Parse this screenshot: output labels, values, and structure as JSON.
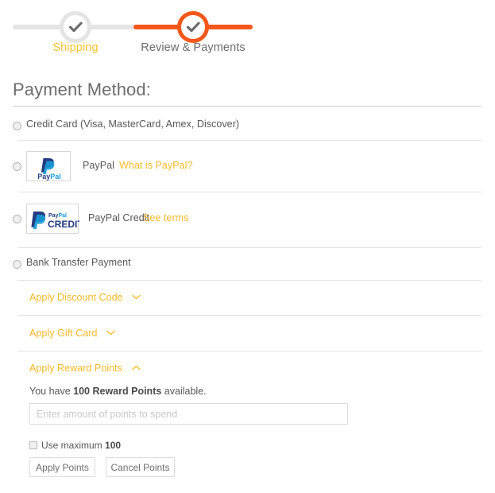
{
  "progress": {
    "steps": [
      {
        "id": "shipping",
        "label": "Shipping",
        "state": "complete",
        "icon": "check-icon",
        "color": "#e4e4e4",
        "label_color": "#f5c432"
      },
      {
        "id": "review-payments",
        "label": "Review & Payments",
        "state": "active",
        "icon": "check-icon",
        "color": "#f3581a",
        "label_color": "#6d6d6d"
      }
    ]
  },
  "page": {
    "title": "Payment Method:"
  },
  "payment_methods": [
    {
      "id": "credit-card",
      "label": "Credit Card (Visa, MasterCard, Amex, Discover)",
      "selected": false,
      "logo": null,
      "link": null
    },
    {
      "id": "paypal",
      "label": "PayPal",
      "selected": false,
      "logo": "paypal-logo",
      "link": "What is PayPal?"
    },
    {
      "id": "paypal-credit",
      "label": "PayPal Credit",
      "selected": false,
      "logo": "paypal-credit-logo",
      "link": "See terms"
    },
    {
      "id": "bank-transfer",
      "label": "Bank Transfer Payment",
      "selected": false,
      "logo": null,
      "link": null
    }
  ],
  "logos": {
    "paypal": {
      "wordmark_pay": "Pay",
      "wordmark_pal": "Pal"
    },
    "paypal_credit": {
      "wordmark": "PayPal",
      "credit": "CREDIT"
    }
  },
  "collapsibles": [
    {
      "id": "discount-code",
      "label": "Apply Discount Code",
      "expanded": false,
      "icon": "chevron-down-icon"
    },
    {
      "id": "gift-card",
      "label": "Apply Gift Card",
      "expanded": false,
      "icon": "chevron-down-icon"
    },
    {
      "id": "reward-points",
      "label": "Apply Reward Points",
      "expanded": true,
      "icon": "chevron-up-icon"
    }
  ],
  "reward_points": {
    "available_prefix": "You have ",
    "available_amount": "100 Reward Points",
    "available_suffix": " available.",
    "input_value": "",
    "input_placeholder": "Enter amount of points to spend",
    "use_maximum_prefix": "Use maximum ",
    "use_maximum_amount": "100",
    "use_maximum_checked": false,
    "apply_label": "Apply Points",
    "cancel_label": "Cancel Points"
  },
  "colors": {
    "accent_orange": "#f3581a",
    "link_gold": "#f5b929",
    "step_gold": "#f5c432",
    "text_gray": "#575757",
    "divider": "#e3e3e3"
  }
}
